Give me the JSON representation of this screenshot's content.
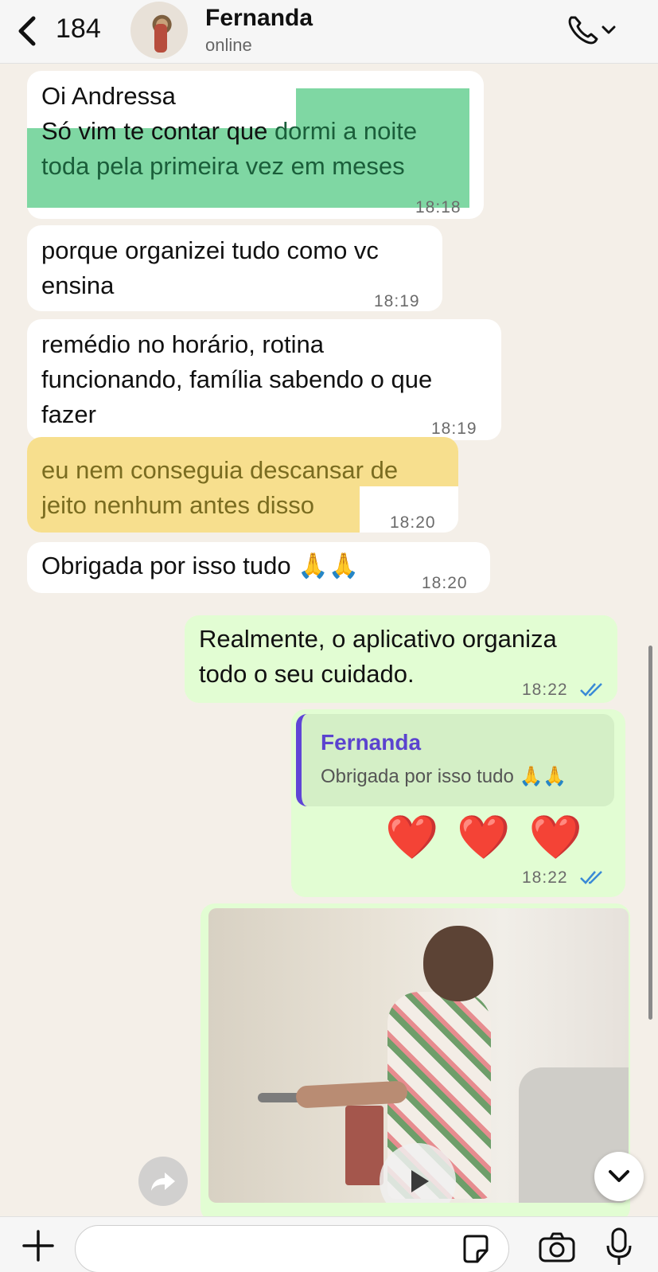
{
  "header": {
    "back_count": "184",
    "contact_name": "Fernanda",
    "contact_status": "online"
  },
  "messages": [
    {
      "id": "m1",
      "direction": "incoming",
      "lines": [
        "Oi Andressa",
        "Só vim te contar que dormi a noite",
        "toda pela primeira vez em meses"
      ],
      "time": "18:18",
      "highlight": "dormi a noite toda pela primeira vez em meses"
    },
    {
      "id": "m2",
      "direction": "incoming",
      "lines": [
        "porque organizei tudo como vc",
        "ensina"
      ],
      "time": "18:19"
    },
    {
      "id": "m3",
      "direction": "incoming",
      "lines": [
        "remédio no horário, rotina",
        "funcionando, família sabendo o que",
        "fazer"
      ],
      "time": "18:19"
    },
    {
      "id": "m4",
      "direction": "incoming",
      "lines": [
        "eu nem conseguia descansar de",
        "jeito nenhum antes disso"
      ],
      "time": "18:20",
      "highlight": "eu nem conseguia descansar de jeito nenhum antes disso"
    },
    {
      "id": "m5",
      "direction": "incoming",
      "lines": [
        "Obrigada por isso tudo 🙏🙏"
      ],
      "time": "18:20"
    },
    {
      "id": "m6",
      "direction": "outgoing",
      "lines": [
        "Realmente, o aplicativo organiza",
        "todo o seu cuidado."
      ],
      "time": "18:22"
    },
    {
      "id": "m7",
      "direction": "outgoing",
      "reply_to": {
        "name": "Fernanda",
        "text": "Obrigada por isso tudo 🙏🙏"
      },
      "body": "❤️ ❤️ ❤️",
      "time": "18:22"
    }
  ],
  "colors": {
    "incoming_bubble": "#ffffff",
    "outgoing_bubble": "#e2fdd3",
    "highlight_green": "#7fd7a3",
    "highlight_yellow": "#f7df8e",
    "reply_accent": "#5f45d6",
    "read_ticks": "#3a8ad6"
  },
  "icons": [
    "chevron-left-icon",
    "phone-icon",
    "chevron-down-icon",
    "play-icon",
    "forward-icon",
    "plus-icon",
    "sticker-icon",
    "camera-icon",
    "mic-icon"
  ]
}
